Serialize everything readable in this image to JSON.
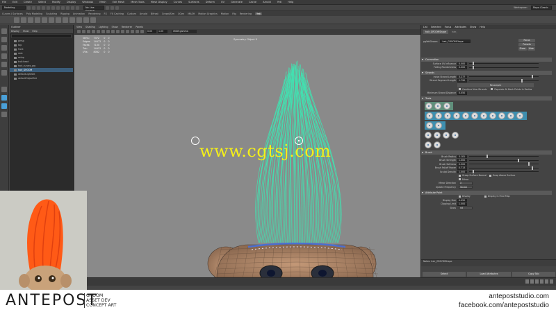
{
  "menubar": {
    "items": [
      "File",
      "Edit",
      "Create",
      "Select",
      "Modify",
      "Display",
      "Windows",
      "Mesh",
      "Edit Mesh",
      "Mesh Tools",
      "Mesh Display",
      "Curves",
      "Surfaces",
      "Deform",
      "UV",
      "Generate",
      "Cache",
      "Arnold",
      "Yeti",
      "Help"
    ],
    "workspace": "Workspace :",
    "workspace_value": "Maya Classic"
  },
  "statusline": {
    "mode": "Modeling",
    "live_surface": "No Live Surface"
  },
  "shelf_tabs": {
    "items": [
      "Curves / Surfaces",
      "Poly Modeling",
      "Sculpting",
      "Rigging",
      "Animation",
      "Rendering",
      "FX",
      "FX Caching",
      "Custom",
      "Arnold",
      "Bifrost",
      "Crowd/Sim",
      "XGen",
      "MASH",
      "Motion Graphics",
      "Motion",
      "Rig",
      "Rendering",
      "Yeti"
    ],
    "active_index": 18
  },
  "outliner": {
    "title": "Outliner",
    "menu": [
      "Display",
      "Show",
      "Help"
    ],
    "items": [
      {
        "label": "persp",
        "hl": false
      },
      {
        "label": "top",
        "hl": false
      },
      {
        "label": "front",
        "hl": false
      },
      {
        "label": "side",
        "hl": false
      },
      {
        "label": "setup",
        "hl": false
      },
      {
        "label": "troll:head",
        "hl": false
      },
      {
        "label": "hair_curves_grp",
        "hl": false
      },
      {
        "label": "hair_GROOM",
        "hl": true
      },
      {
        "label": "defaultLightSet",
        "hl": false
      },
      {
        "label": "defaultObjectSet",
        "hl": false
      }
    ]
  },
  "viewport": {
    "menu": [
      "View",
      "Shading",
      "Lighting",
      "Show",
      "Renderer",
      "Panels"
    ],
    "colorspace": "sRGB gamma",
    "exposure": "0.00",
    "gamma": "1.00",
    "symmetry": "Symmetry: Object X",
    "hud": [
      [
        "Verts:",
        "7372",
        "0",
        "0"
      ],
      [
        "Edges:",
        "14472",
        "0",
        "0"
      ],
      [
        "Faces:",
        "7100",
        "0",
        "0"
      ],
      [
        "Tris:",
        "14412",
        "0",
        "0"
      ],
      [
        "UVs:",
        "8082",
        "0",
        "0"
      ]
    ]
  },
  "watermark": "www.cgtsj.com",
  "attr_editor": {
    "tabs": [
      "List",
      "Selected",
      "Focus",
      "Attributes",
      "Show",
      "Help"
    ],
    "node_tab": "hair_GROOMShape",
    "node_tab2": "hair_",
    "node_label": "pgYetiGroom:",
    "node_value": "hair_GROOMShape",
    "buttons": {
      "focus": "Focus",
      "presets": "Presets",
      "show": "Show",
      "hide": "Hide"
    },
    "sections": {
      "connection": "Connection",
      "strands": "Strands",
      "tools": "Tools",
      "brush": "Brush",
      "attribute_paint": "Attribute Paint"
    },
    "connection_rows": [
      {
        "label": "Surface UV Influence",
        "value": "0.000",
        "pos": 0.05
      },
      {
        "label": "Falling Randomness",
        "value": "0.000",
        "pos": 0.05
      }
    ],
    "strand_rows": [
      {
        "label": "Initial Strand Length",
        "value": "3.277",
        "pos": 0.9
      },
      {
        "label": "Strand Segment Length",
        "value": "1.790",
        "pos": 0.75
      }
    ],
    "resample": "Resample",
    "strand_checks": {
      "a": "Combine New Strands",
      "b": "Populate At Mesh Points In Radius"
    },
    "min_distance": {
      "label": "Minimum Strand Distance",
      "value": "0.050"
    },
    "brush_rows": [
      {
        "label": "Brush Radius",
        "value": "3.181",
        "pos": 0.25
      },
      {
        "label": "Brush Strength",
        "value": "1.000",
        "pos": 0.7
      },
      {
        "label": "Brush Softness",
        "value": "0.500",
        "pos": 0.85
      },
      {
        "label": "Brush Falloff Power",
        "value": "0.713",
        "pos": 0.9
      },
      {
        "label": "Sculpt Density",
        "value": "1.000",
        "pos": 0.05
      }
    ],
    "brush_checks": {
      "a": "Grasp Surface Normal",
      "b": "Snap Above Surface",
      "c": "Mirror"
    },
    "mirror_direction": {
      "label": "Mirror Direction",
      "value": "X"
    },
    "update_frequency": {
      "label": "Update Frequency",
      "value": "Stroke"
    },
    "paint_checks": {
      "a": "Display",
      "b": "Display In Final Map"
    },
    "display_size": {
      "label": "Display Size",
      "value": "0.050"
    },
    "clipping_limit": {
      "label": "Clipping Limit",
      "value": "1.000"
    },
    "show": {
      "label": "Show",
      "value": "nd"
    },
    "notes": "Notes:  hair_GROOMShape",
    "bottom": {
      "select": "Select",
      "load": "Load Attributes",
      "copy": "Copy Tab"
    }
  },
  "branding": {
    "logo": "ANTEPOST",
    "sub": [
      "GROOM",
      "ASSET DEV",
      "CONCEPT ART"
    ],
    "website": "antepoststudio.com",
    "facebook": "facebook.com/antepoststudio"
  },
  "colors": {
    "accent_blue": "#3e8fb0",
    "hair_green": "#43e0b0",
    "watermark": "#f4ef19"
  }
}
